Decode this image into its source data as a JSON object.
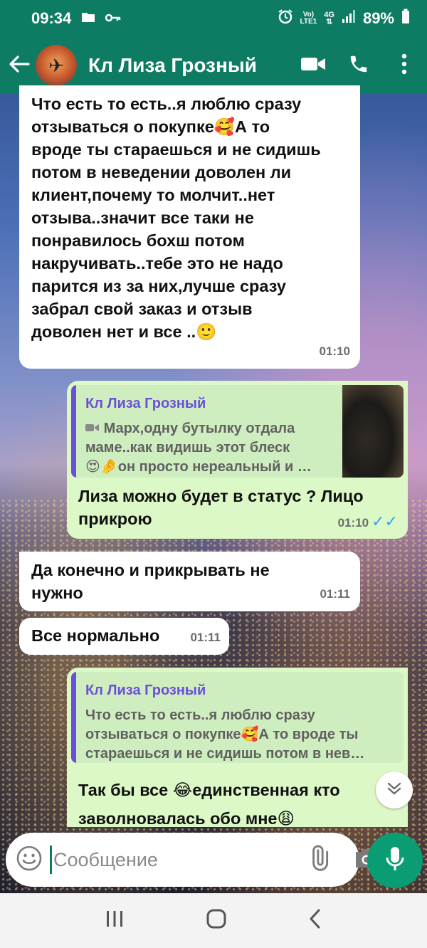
{
  "status_bar": {
    "time": "09:34",
    "network_top": "Vo)",
    "network_bottom": "LTE1",
    "network_type": "4G",
    "battery": "89%"
  },
  "header": {
    "contact_name": "Кл Лиза Грозный",
    "icons": [
      "back-arrow-icon",
      "video-call-icon",
      "phone-icon",
      "more-vert-icon"
    ]
  },
  "messages": [
    {
      "direction": "in",
      "text_lines": [
        "Что есть то есть..я люблю сразу",
        "отзываться о покупке🥰А то",
        "вроде ты стараешься и не сидишь",
        "потом в неведении доволен ли",
        "клиент,почему то молчит..нет",
        "отзыва..значит все таки не",
        "понравилось бохш потом",
        "накручивать..тебе это не надо",
        "парится из за них,лучше сразу",
        "забрал свой заказ и отзыв",
        "доволен нет и все ..🙂"
      ],
      "time": "01:10"
    },
    {
      "direction": "out",
      "quote": {
        "author": "Кл Лиза Грозный",
        "lines": [
          "Марх,одну бутылку отдала",
          "маме..как видишь этот блеск",
          "😍🤌он просто нереальный и …"
        ]
      },
      "text_lines": [
        "Лиза можно будет в статус ? Лицо",
        "прикрою"
      ],
      "time": "01:10",
      "status": "read"
    },
    {
      "direction": "in",
      "text_lines": [
        "Да конечно и прикрывать не",
        "нужно"
      ],
      "time": "01:11"
    },
    {
      "direction": "in",
      "text_lines": [
        "Все нормально"
      ],
      "time": "01:11"
    },
    {
      "direction": "out",
      "quote": {
        "author": "Кл Лиза Грозный",
        "lines": [
          "Что есть то есть..я люблю сразу",
          "отзываться о покупке🥰А то вроде ты",
          "стараешься и не сидишь потом в нев…"
        ]
      },
      "text_lines": [
        "Так бы все 😂единственная кто",
        "заволновалась обо мне😩"
      ]
    }
  ],
  "composer": {
    "placeholder": "Сообщение"
  },
  "colors": {
    "header": "#0e7c63",
    "incoming": "#ffffff",
    "outgoing": "#dcf8c6",
    "quote_author": "#6c4fd8",
    "read_ticks": "#35a6e8",
    "mic_button": "#0a9d74"
  }
}
